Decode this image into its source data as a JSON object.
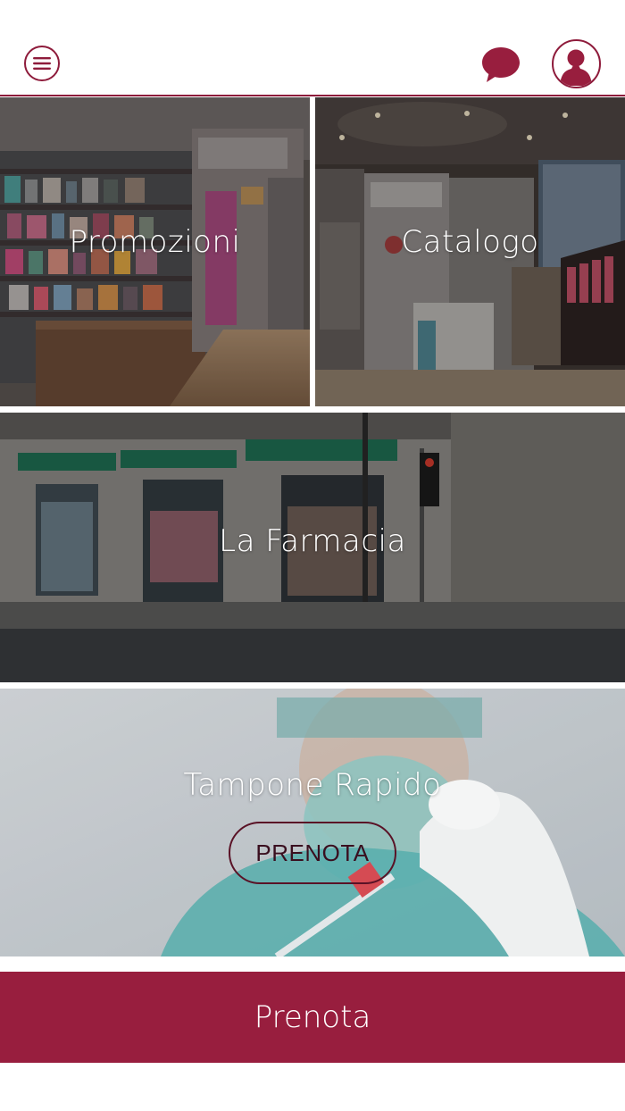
{
  "colors": {
    "brand": "#981e3e",
    "brand_dark": "#8e1b3b",
    "white": "#ffffff"
  },
  "header": {
    "menu_icon": "hamburger-menu-icon",
    "chat_icon": "chat-bubble-icon",
    "profile_icon": "user-profile-icon"
  },
  "tiles": {
    "promozioni": {
      "label": "Promozioni",
      "photo": "pharmacy shelves interior"
    },
    "catalogo": {
      "label": "Catalogo",
      "photo": "pharmacy counter interior"
    },
    "farmacia": {
      "label": "La Farmacia",
      "photo": "pharmacy storefront exterior"
    },
    "tampone": {
      "label": "Tampone Rapido",
      "button_label": "PRENOTA",
      "photo": "rapid swab test"
    }
  },
  "footer": {
    "prenota_label": "Prenota"
  }
}
